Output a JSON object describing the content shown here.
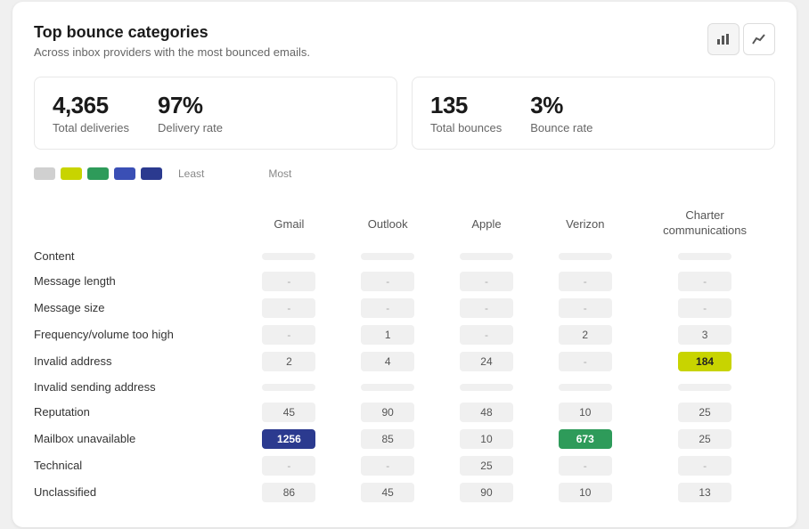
{
  "card": {
    "title": "Top bounce categories",
    "subtitle": "Across inbox providers with the most bounced emails."
  },
  "chart_buttons": [
    {
      "label": "bar-chart-icon",
      "icon": "▦",
      "active": true
    },
    {
      "label": "line-chart-icon",
      "icon": "╱",
      "active": false
    }
  ],
  "stats": [
    {
      "items": [
        {
          "value": "4,365",
          "label": "Total deliveries"
        },
        {
          "value": "97%",
          "label": "Delivery rate"
        }
      ]
    },
    {
      "items": [
        {
          "value": "135",
          "label": "Total bounces"
        },
        {
          "value": "3%",
          "label": "Bounce rate"
        }
      ]
    }
  ],
  "legend": {
    "least_label": "Least",
    "most_label": "Most",
    "swatches": [
      "#d0d0d0",
      "#c8d400",
      "#2e9b5a",
      "#3a4fb5",
      "#2b3a8f"
    ]
  },
  "table": {
    "columns": [
      "",
      "Gmail",
      "Outlook",
      "Apple",
      "Verizon",
      "Charter\ncommunications"
    ],
    "rows": [
      {
        "category": "Content",
        "cells": [
          {
            "value": "",
            "type": "empty"
          },
          {
            "value": "",
            "type": "empty"
          },
          {
            "value": "",
            "type": "empty"
          },
          {
            "value": "",
            "type": "empty"
          },
          {
            "value": "",
            "type": "empty"
          }
        ]
      },
      {
        "category": "Message length",
        "cells": [
          {
            "value": "-",
            "type": "dash"
          },
          {
            "value": "-",
            "type": "dash"
          },
          {
            "value": "-",
            "type": "dash"
          },
          {
            "value": "-",
            "type": "dash"
          },
          {
            "value": "-",
            "type": "dash"
          }
        ]
      },
      {
        "category": "Message size",
        "cells": [
          {
            "value": "-",
            "type": "dash"
          },
          {
            "value": "-",
            "type": "dash"
          },
          {
            "value": "-",
            "type": "dash"
          },
          {
            "value": "-",
            "type": "dash"
          },
          {
            "value": "-",
            "type": "dash"
          }
        ]
      },
      {
        "category": "Frequency/volume too high",
        "cells": [
          {
            "value": "-",
            "type": "dash"
          },
          {
            "value": "1",
            "type": "normal"
          },
          {
            "value": "-",
            "type": "dash"
          },
          {
            "value": "2",
            "type": "normal"
          },
          {
            "value": "3",
            "type": "normal"
          }
        ]
      },
      {
        "category": "Invalid address",
        "cells": [
          {
            "value": "2",
            "type": "normal"
          },
          {
            "value": "4",
            "type": "normal"
          },
          {
            "value": "24",
            "type": "normal"
          },
          {
            "value": "-",
            "type": "dash"
          },
          {
            "value": "184",
            "type": "yellow"
          }
        ]
      },
      {
        "category": "Invalid sending address",
        "cells": [
          {
            "value": "",
            "type": "empty"
          },
          {
            "value": "",
            "type": "empty"
          },
          {
            "value": "",
            "type": "empty"
          },
          {
            "value": "",
            "type": "empty"
          },
          {
            "value": "",
            "type": "empty"
          }
        ]
      },
      {
        "category": "Reputation",
        "cells": [
          {
            "value": "45",
            "type": "normal"
          },
          {
            "value": "90",
            "type": "normal"
          },
          {
            "value": "48",
            "type": "normal"
          },
          {
            "value": "10",
            "type": "normal"
          },
          {
            "value": "25",
            "type": "normal"
          }
        ]
      },
      {
        "category": "Mailbox unavailable",
        "cells": [
          {
            "value": "1256",
            "type": "blue"
          },
          {
            "value": "85",
            "type": "normal"
          },
          {
            "value": "10",
            "type": "normal"
          },
          {
            "value": "673",
            "type": "green"
          },
          {
            "value": "25",
            "type": "normal"
          }
        ]
      },
      {
        "category": "Technical",
        "cells": [
          {
            "value": "-",
            "type": "dash"
          },
          {
            "value": "-",
            "type": "dash"
          },
          {
            "value": "25",
            "type": "normal"
          },
          {
            "value": "-",
            "type": "dash"
          },
          {
            "value": "-",
            "type": "dash"
          }
        ]
      },
      {
        "category": "Unclassified",
        "cells": [
          {
            "value": "86",
            "type": "normal"
          },
          {
            "value": "45",
            "type": "normal"
          },
          {
            "value": "90",
            "type": "normal"
          },
          {
            "value": "10",
            "type": "normal"
          },
          {
            "value": "13",
            "type": "normal"
          }
        ]
      }
    ]
  }
}
